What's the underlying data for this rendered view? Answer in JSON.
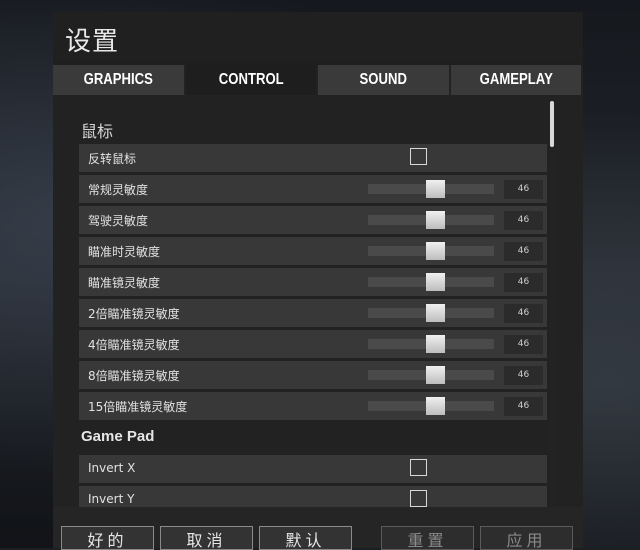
{
  "window": {
    "title": "设置"
  },
  "tabs": [
    {
      "label": "GRAPHICS",
      "active": false
    },
    {
      "label": "CONTROL",
      "active": true
    },
    {
      "label": "SOUND",
      "active": false
    },
    {
      "label": "GAMEPLAY",
      "active": false
    }
  ],
  "sections": {
    "mouse": {
      "title": "鼠标",
      "invert_label": "反转鼠标",
      "invert_checked": false,
      "sliders": [
        {
          "label": "常规灵敏度",
          "value": "46",
          "level": 0.46
        },
        {
          "label": "驾驶灵敏度",
          "value": "46",
          "level": 0.46
        },
        {
          "label": "瞄准时灵敏度",
          "value": "46",
          "level": 0.46
        },
        {
          "label": "瞄准镜灵敏度",
          "value": "46",
          "level": 0.46
        },
        {
          "label": "2倍瞄准镜灵敏度",
          "value": "46",
          "level": 0.46
        },
        {
          "label": "4倍瞄准镜灵敏度",
          "value": "46",
          "level": 0.46
        },
        {
          "label": "8倍瞄准镜灵敏度",
          "value": "46",
          "level": 0.46
        },
        {
          "label": "15倍瞄准镜灵敏度",
          "value": "46",
          "level": 0.46
        }
      ]
    },
    "gamepad": {
      "title": "Game Pad",
      "toggles": [
        {
          "label": "Invert X",
          "checked": false
        },
        {
          "label": "Invert Y",
          "checked": false
        }
      ]
    }
  },
  "buttons": {
    "ok": "好的",
    "cancel": "取消",
    "default": "默认",
    "reset": "重置",
    "apply": "应用"
  },
  "colors": {
    "panel": "#1f1f1f",
    "row": "#383838",
    "accent_text": "#e2e2e2"
  }
}
